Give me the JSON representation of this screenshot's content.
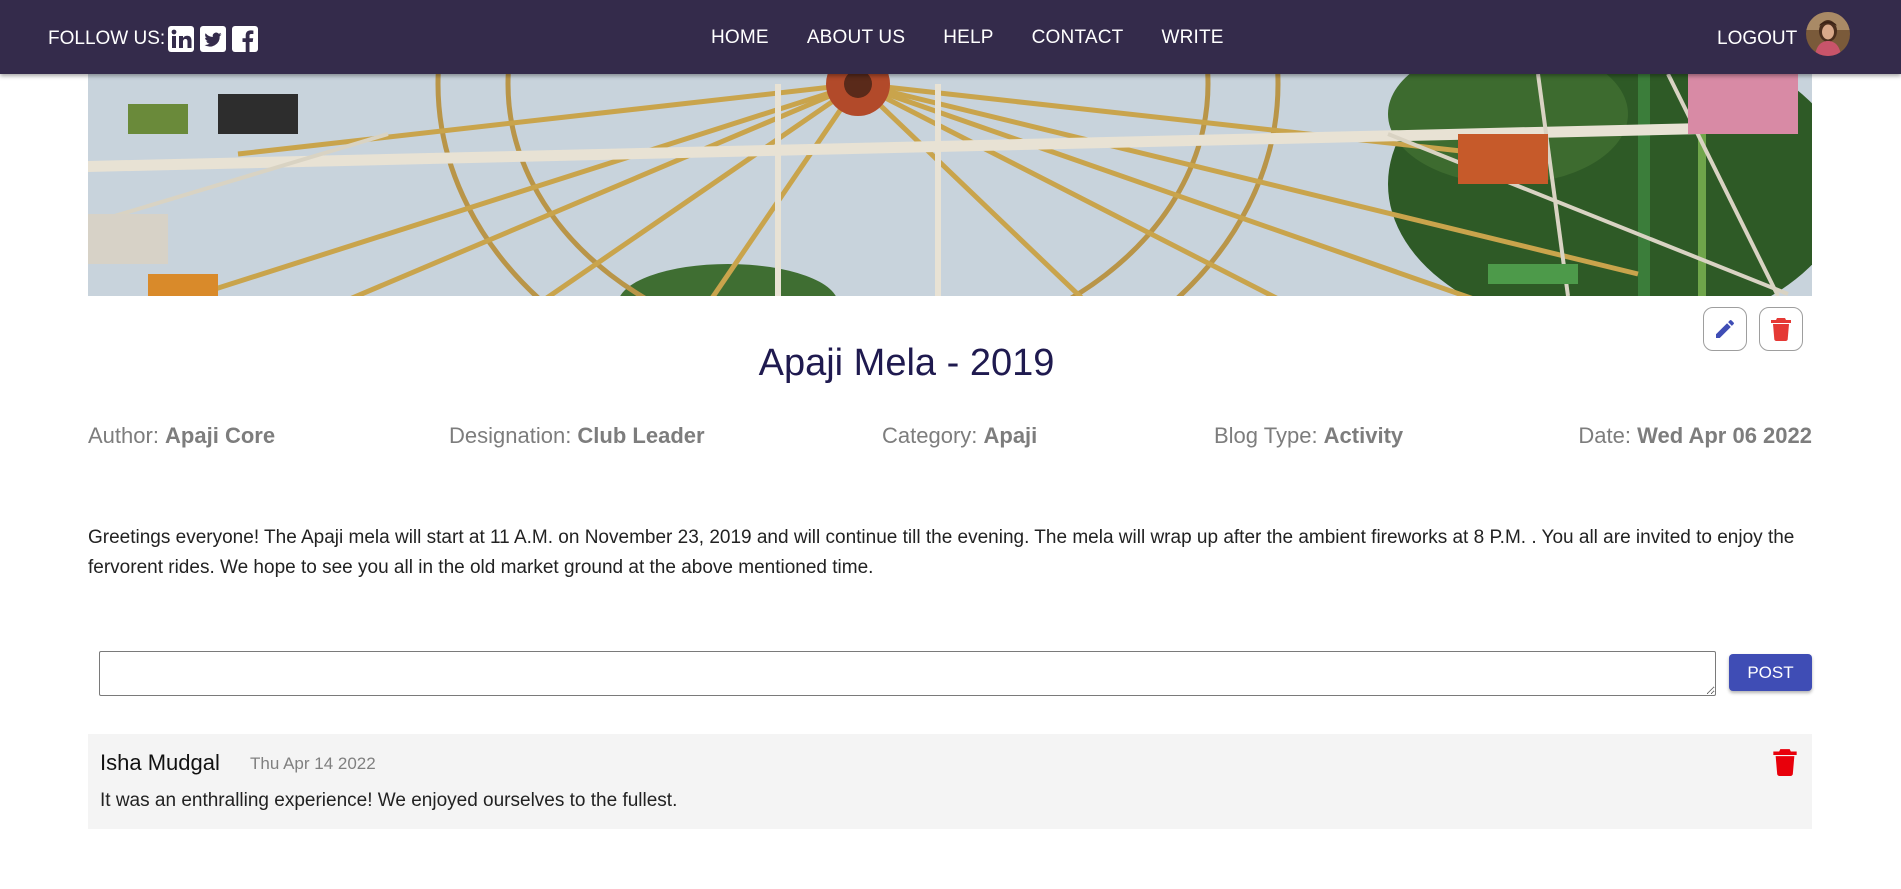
{
  "header": {
    "follow_label": "FOLLOW US:",
    "social": [
      "linkedin-icon",
      "twitter-icon",
      "facebook-icon"
    ],
    "nav": [
      "HOME",
      "ABOUT US",
      "HELP",
      "CONTACT",
      "WRITE"
    ],
    "logout_label": "LOGOUT",
    "bg_color": "#342b4b"
  },
  "post": {
    "title": "Apaji Mela - 2019",
    "meta": {
      "author_label": "Author: ",
      "author": "Apaji Core",
      "designation_label": "Designation: ",
      "designation": "Club Leader",
      "category_label": "Category: ",
      "category": "Apaji",
      "blog_type_label": "Blog Type: ",
      "blog_type": "Activity",
      "date_label": "Date: ",
      "date": "Wed Apr 06 2022"
    },
    "body": "Greetings everyone! The Apaji mela will start at 11 A.M. on November 23, 2019 and will continue till the evening. The mela will wrap up after the ambient fireworks at 8 P.M. . You all are invited to enjoy the fervorent rides. We hope to see you all in the old market ground at the above mentioned time."
  },
  "comment_form": {
    "value": "",
    "post_label": "POST"
  },
  "comments": [
    {
      "author": "Isha Mudgal",
      "date": "Thu Apr 14 2022",
      "text": "It was an enthralling experience! We enjoyed ourselves to the fullest."
    }
  ],
  "colors": {
    "accent": "#3f4db5",
    "title": "#1f1a4f",
    "delete": "#e53935"
  }
}
